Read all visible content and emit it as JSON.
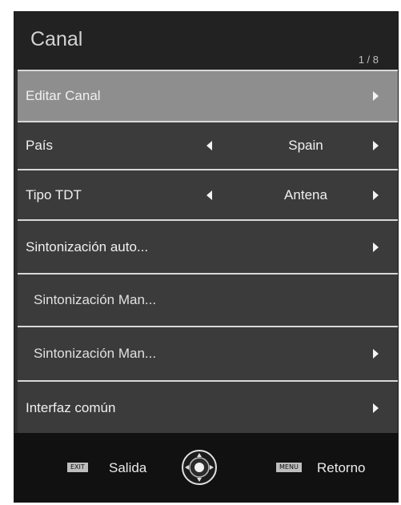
{
  "menu": {
    "title": "Canal",
    "page_indicator": "1 / 8",
    "items": [
      {
        "label": "Editar Canal",
        "selected": true
      },
      {
        "label": "País",
        "value": "Spain"
      },
      {
        "label": "Tipo TDT",
        "value": "Antena"
      },
      {
        "label": "Sintonización auto..."
      },
      {
        "label": "Sintonización Man..."
      },
      {
        "label": "Sintonización Man..."
      },
      {
        "label": "Interfaz común"
      }
    ]
  },
  "footer": {
    "exit_badge": "EXIT",
    "exit_label": "Salida",
    "menu_badge": "MENU",
    "menu_label": "Retorno"
  },
  "colors": {
    "panel": "#2f2f2f",
    "header": "#222222",
    "row": "#3b3b3b",
    "row_selected": "#8e8e8e",
    "footer": "#111111",
    "divider": "#d8d8d8"
  },
  "icons": {
    "right_arrow": "triangle-right",
    "left_arrow": "triangle-left",
    "navigation": "dpad"
  }
}
